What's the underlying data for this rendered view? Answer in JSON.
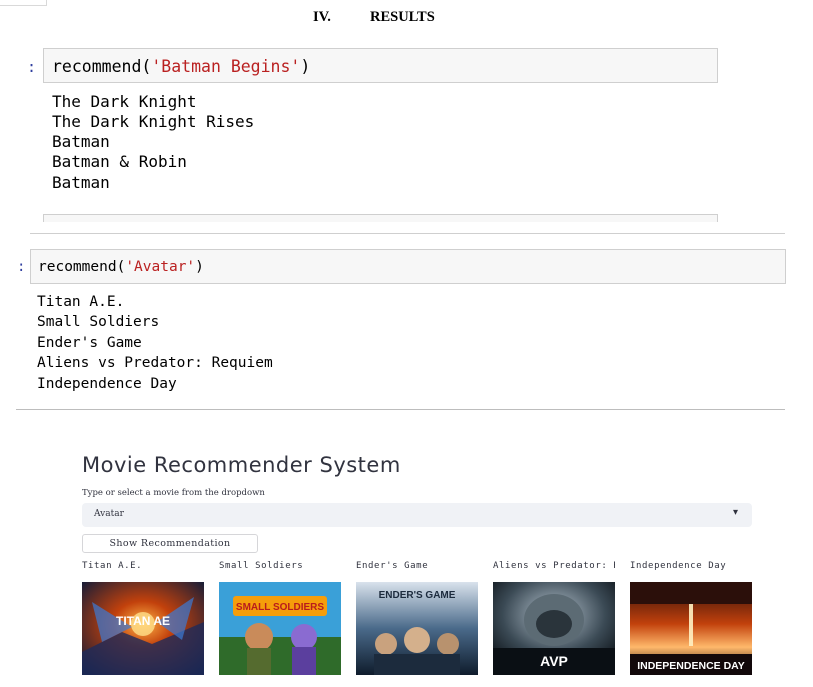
{
  "heading": {
    "number": "IV.",
    "title": "RESULTS"
  },
  "cells": [
    {
      "prompt": ":",
      "code_prefix": "recommend(",
      "code_arg": "'Batman Begins'",
      "code_suffix": ")",
      "outputs": [
        "The Dark Knight",
        "The Dark Knight Rises",
        "Batman",
        "Batman & Robin",
        "Batman"
      ]
    },
    {
      "prompt": ":",
      "code_prefix": "recommend(",
      "code_arg": "'Avatar'",
      "code_suffix": ")",
      "outputs": [
        "Titan A.E.",
        "Small Soldiers",
        "Ender's Game",
        "Aliens vs Predator: Requiem",
        "Independence Day"
      ]
    }
  ],
  "app": {
    "title": "Movie Recommender System",
    "select_label": "Type or select a movie from the dropdown",
    "select_value": "Avatar",
    "button_label": "Show Recommendation",
    "movies": [
      {
        "name": "Titan A.E.",
        "poster_text": "TITAN AE"
      },
      {
        "name": "Small Soldiers",
        "poster_text": "SMALL SOLDIERS"
      },
      {
        "name": "Ender's Game",
        "poster_text": "ENDER'S GAME"
      },
      {
        "name": "Aliens vs Predator: Requiem",
        "poster_text": "AVP"
      },
      {
        "name": "Independence Day",
        "poster_text": "INDEPENDENCE DAY"
      }
    ],
    "colors": {
      "prompt": "#303f9f",
      "string": "#ba2121",
      "select_bg": "#f0f2f6",
      "text": "#31333f"
    }
  }
}
